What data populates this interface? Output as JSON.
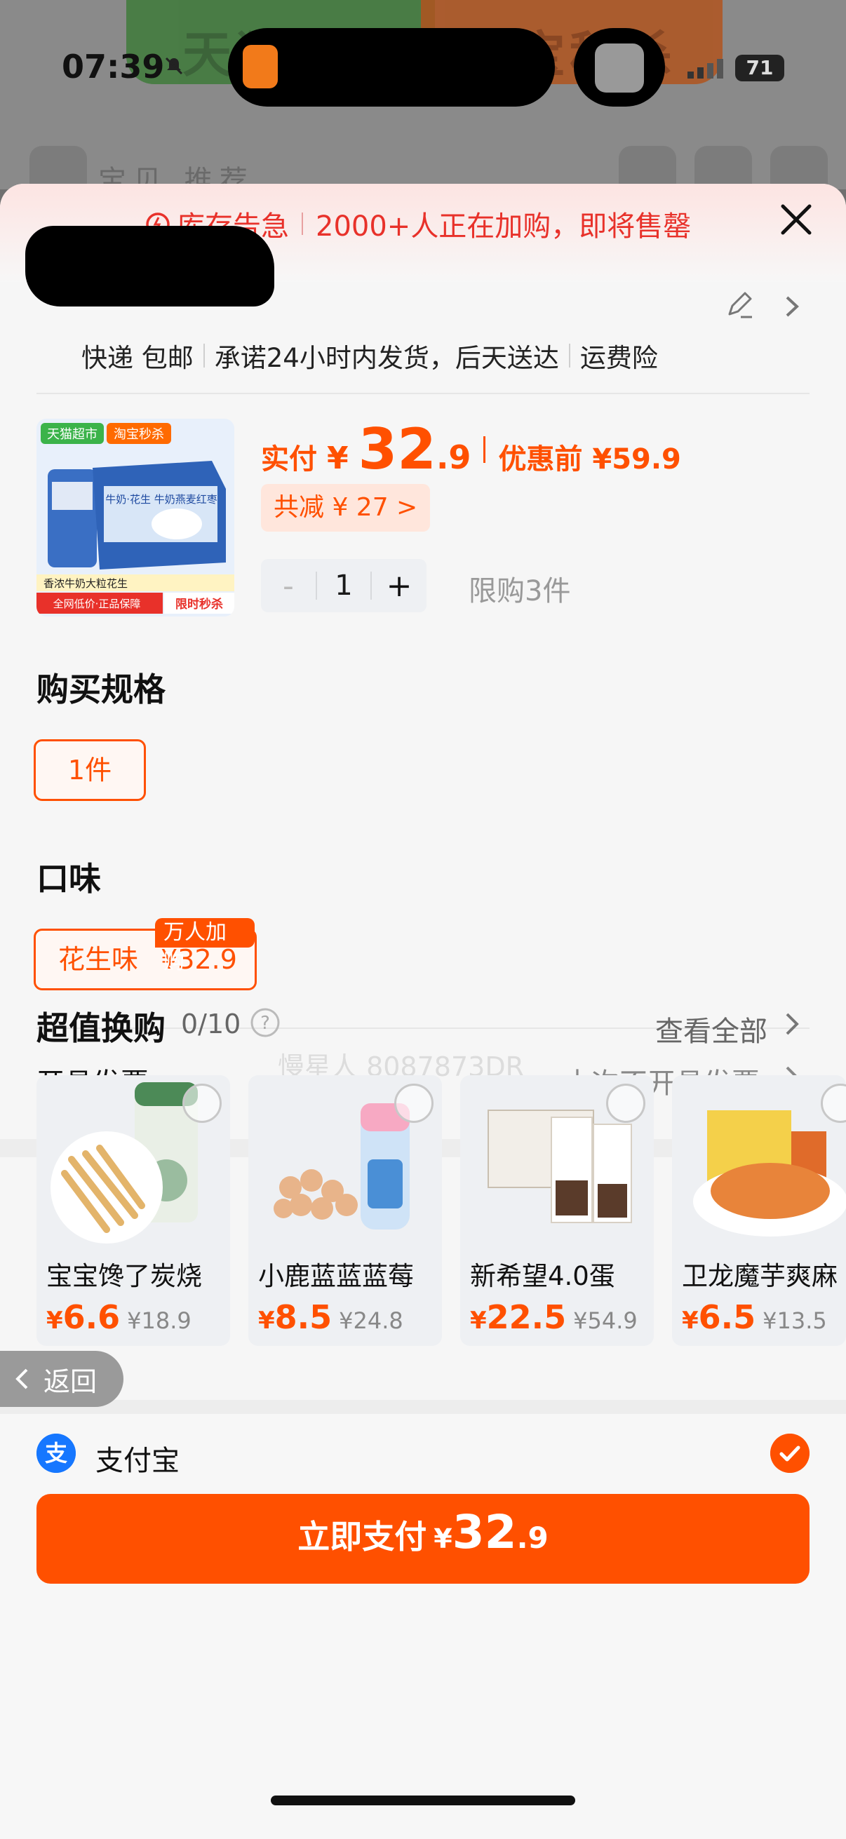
{
  "status": {
    "time": "07:39",
    "battery": "71"
  },
  "background": {
    "banner_left": "天猫超市",
    "banner_right": "淘宝秒杀",
    "nav_text": "宝贝 推荐"
  },
  "alert": {
    "left": "库存告急",
    "right": "2000+人正在加购，即将售罄"
  },
  "shipping": {
    "item1": "快递 包邮",
    "item2": "承诺24小时内发货，后天送达",
    "item3": "运费险"
  },
  "product": {
    "pay_label": "实付",
    "currency": "¥",
    "price_int": "32",
    "price_dec": ".9",
    "original_label": "优惠前 ¥59.9",
    "savings": "共减 ¥ 27 >",
    "quantity": "1",
    "minus": "-",
    "plus": "+",
    "limit": "限购3件",
    "image_text": {
      "tag1": "天猫超市",
      "tag2": "淘宝秒杀",
      "box_text": "牛奶·花生 牛奶燕麦红枣",
      "strip1": "香浓牛奶大粒花生",
      "strip2": "全网低价·正品保障",
      "strip3": "限时秒杀"
    }
  },
  "spec": {
    "title": "购买规格",
    "option": "1件"
  },
  "flavor": {
    "title": "口味",
    "option_name": "花生味",
    "option_price": "¥32.9",
    "tag": "万人加购"
  },
  "watermark": "慢星人 8087873DR",
  "invoice": {
    "label": "开具发票",
    "value": "本次不开具发票"
  },
  "tradein": {
    "title": "超值换购",
    "count": "0/10",
    "see_all": "查看全部",
    "items": [
      {
        "name": "宝宝馋了炭烧",
        "yen": "¥",
        "price": "6.6",
        "was": "¥18.9"
      },
      {
        "name": "小鹿蓝蓝蓝莓",
        "yen": "¥",
        "price": "8.5",
        "was": "¥24.8"
      },
      {
        "name": "新希望4.0蛋",
        "yen": "¥",
        "price": "22.5",
        "was": "¥54.9"
      },
      {
        "name": "卫龙魔芋爽麻",
        "yen": "¥",
        "price": "6.5",
        "was": "¥13.5"
      }
    ]
  },
  "back": "返回",
  "payment": {
    "method": "支付宝"
  },
  "pay_button": {
    "label": "立即支付",
    "yen": "¥",
    "int": "32",
    "dec": ".9"
  },
  "colors": {
    "accent": "#ff5000",
    "alert": "#e8312a",
    "alipay": "#1677ff"
  }
}
